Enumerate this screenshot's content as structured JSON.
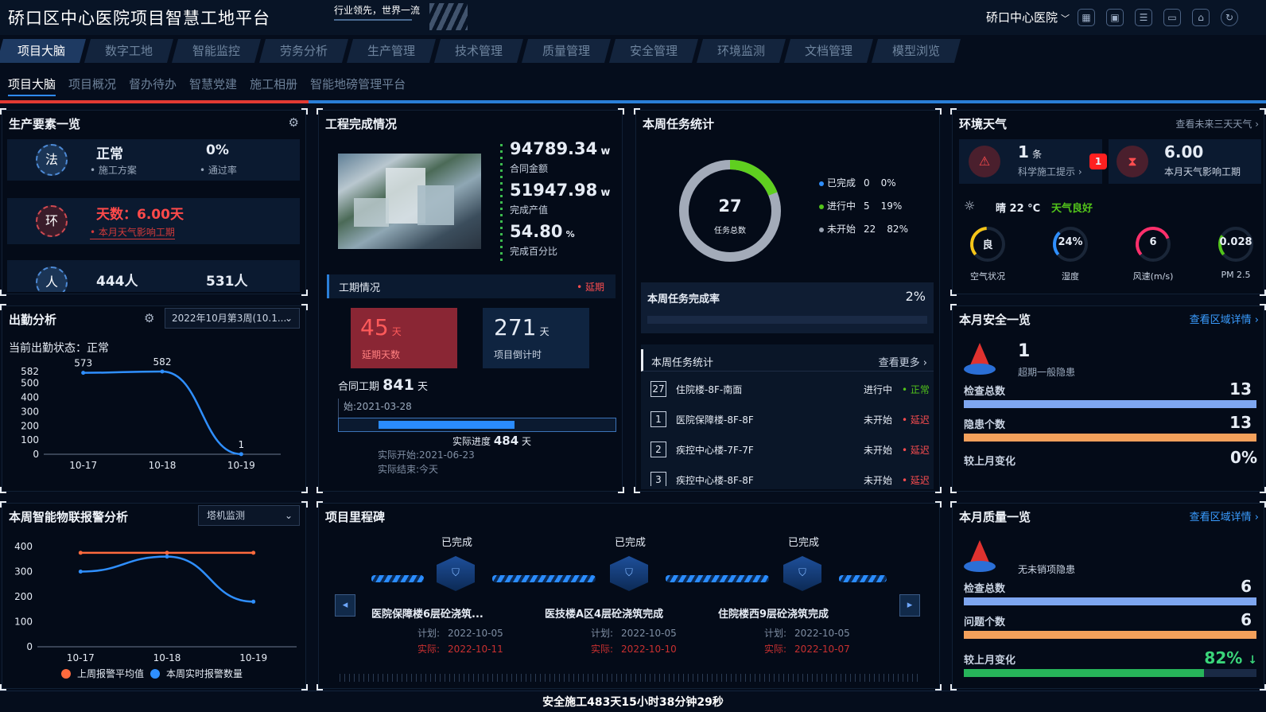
{
  "header": {
    "title": "硚口区中心医院项目智慧工地平台",
    "slogan": "行业领先，世界一流",
    "hospital": "硚口中心医院",
    "hospital_caret": "﹀",
    "icons": [
      "grid-icon",
      "image-icon",
      "list-icon",
      "monitor-icon",
      "shirt-icon",
      "refresh-icon"
    ]
  },
  "nav1": [
    "项目大脑",
    "数字工地",
    "智能监控",
    "劳务分析",
    "生产管理",
    "技术管理",
    "质量管理",
    "安全管理",
    "环境监测",
    "文档管理",
    "模型浏览"
  ],
  "nav2": [
    "项目大脑",
    "项目概况",
    "督办待办",
    "智慧党建",
    "施工相册",
    "智能地磅管理平台"
  ],
  "production": {
    "title": "生产要素一览",
    "r1": {
      "badge": "法",
      "v1": "正常",
      "l1": "施工方案",
      "v2": "0%",
      "l2": "通过率"
    },
    "r2": {
      "badge": "环",
      "text": "天数：6.00天",
      "sub": "本月天气影响工期"
    },
    "r3": {
      "badge": "人",
      "v1": "444人",
      "v2": "531人"
    }
  },
  "attendance": {
    "title": "出勤分析",
    "select": "2022年10月第3周(10.1...",
    "status": "当前出勤状态：正常"
  },
  "chart_data": [
    {
      "type": "line",
      "title": "出勤分析",
      "categories": [
        "10-17",
        "10-18",
        "10-19"
      ],
      "series": [
        {
          "values": [
            573,
            582,
            1
          ]
        }
      ],
      "yticks": [
        0,
        100,
        200,
        300,
        400,
        500,
        582
      ],
      "ylim": [
        0,
        582
      ],
      "point_labels": [
        "573",
        "582",
        "1"
      ],
      "color": "#2f8fff"
    },
    {
      "type": "line",
      "title": "本周智能物联报警分析",
      "categories": [
        "10-17",
        "10-18",
        "10-19"
      ],
      "series": [
        {
          "name": "上周报警平均值",
          "values": [
            375,
            375,
            375
          ],
          "color": "#ff6a3d"
        },
        {
          "name": "本周实时报警数量",
          "values": [
            300,
            360,
            180
          ],
          "color": "#2f8fff"
        }
      ],
      "yticks": [
        0,
        100,
        200,
        300,
        400
      ],
      "ylim": [
        0,
        400
      ],
      "legend": "bottom"
    }
  ],
  "engineering": {
    "title": "工程完成情况",
    "amount": "94789.34",
    "amount_unit": "w",
    "amount_label": "合同金额",
    "output": "51947.98",
    "output_unit": "w",
    "output_label": "完成产值",
    "pct": "54.80",
    "pct_unit": "%",
    "pct_label": "完成百分比",
    "period_title": "工期情况",
    "delay_tag": "延期",
    "delay_days": "45",
    "delay_unit": "天",
    "delay_label": "延期天数",
    "countdown": "271",
    "countdown_unit": "天",
    "countdown_label": "项目倒计时",
    "contract_label": "合同工期",
    "contract_days": "841",
    "contract_unit": "天",
    "start": "始:2021-03-28",
    "actual_label": "实际进度",
    "actual_days": "484",
    "actual_unit": "天",
    "actual_start": "实际开始:2021-06-23",
    "actual_end": "实际结束:今天",
    "progress": 0.58
  },
  "weekly": {
    "title": "本周任务统计",
    "total": "27",
    "total_label": "任务总数",
    "legend": [
      {
        "label": "已完成",
        "count": "0",
        "pct": "0%",
        "color": "#2f8fff"
      },
      {
        "label": "进行中",
        "count": "5",
        "pct": "19%",
        "color": "#52c41a"
      },
      {
        "label": "未开始",
        "count": "22",
        "pct": "82%",
        "color": "#9aa3b2"
      }
    ],
    "done_frac": 0.19,
    "rate_label": "本周任务完成率",
    "rate": "2%",
    "list_title": "本周任务统计",
    "more": "查看更多",
    "tasks": [
      {
        "no": "27",
        "name": "住院楼-8F-南面",
        "state": "进行中",
        "flag": "正常",
        "color": "#52c41a"
      },
      {
        "no": "1",
        "name": "医院保障楼-8F-8F",
        "state": "未开始",
        "flag": "延迟",
        "color": "#ff4d4f"
      },
      {
        "no": "2",
        "name": "疾控中心楼-7F-7F",
        "state": "未开始",
        "flag": "延迟",
        "color": "#ff4d4f"
      },
      {
        "no": "3",
        "name": "疾控中心楼-8F-8F",
        "state": "未开始",
        "flag": "延迟",
        "color": "#ff4d4f"
      }
    ]
  },
  "weather": {
    "title": "环境天气",
    "more": "查看未来三天天气",
    "tip_count": "1",
    "tip_unit": "条",
    "tip_label": "科学施工提示",
    "tip_badge": "1",
    "impact": "6.00",
    "impact_label": "本月天气影响工期",
    "now": "晴 22 °C",
    "quality": "天气良好",
    "gauges": [
      {
        "value": "良",
        "label": "空气状况",
        "color": "#f5c518",
        "frac": 0.35
      },
      {
        "value": "24%",
        "label": "湿度",
        "color": "#2f8fff",
        "frac": 0.24
      },
      {
        "value": "6",
        "label": "风速(m/s)",
        "color": "#ff2f6b",
        "frac": 0.55
      },
      {
        "value": "0.028",
        "label": "PM 2.5",
        "color": "#52c41a",
        "frac": 0.2
      }
    ]
  },
  "safety": {
    "title": "本月安全一览",
    "link": "查看区域详情",
    "big": "1",
    "big_label": "超期一般隐患",
    "rows": [
      {
        "label": "检查总数",
        "value": "13",
        "color": "#7ea6f0",
        "frac": 1
      },
      {
        "label": "隐患个数",
        "value": "13",
        "color": "#f4a05b",
        "frac": 1
      }
    ],
    "change_label": "较上月变化",
    "change": "0%"
  },
  "alarm": {
    "title": "本周智能物联报警分析",
    "select": "塔机监测"
  },
  "milestone": {
    "title": "项目里程碑",
    "items": [
      {
        "status": "已完成",
        "name": "医院保障楼6层砼浇筑...",
        "plan_label": "计划:",
        "plan": "2022-10-05",
        "actual_label": "实际:",
        "actual": "2022-10-11"
      },
      {
        "status": "已完成",
        "name": "医技楼A区4层砼浇筑完成",
        "plan_label": "计划:",
        "plan": "2022-10-05",
        "actual_label": "实际:",
        "actual": "2022-10-10"
      },
      {
        "status": "已完成",
        "name": "住院楼西9层砼浇筑完成",
        "plan_label": "计划:",
        "plan": "2022-10-05",
        "actual_label": "实际:",
        "actual": "2022-10-07"
      }
    ]
  },
  "quality": {
    "title": "本月质量一览",
    "link": "查看区域详情",
    "note": "无未销项隐患",
    "rows": [
      {
        "label": "检查总数",
        "value": "6",
        "color": "#7ea6f0",
        "frac": 1
      },
      {
        "label": "问题个数",
        "value": "6",
        "color": "#f4a05b",
        "frac": 1
      }
    ],
    "change_label": "较上月变化",
    "change": "82%",
    "change_arrow": "↓",
    "change_frac": 0.82
  },
  "footer": "安全施工483天15小时38分钟29秒"
}
